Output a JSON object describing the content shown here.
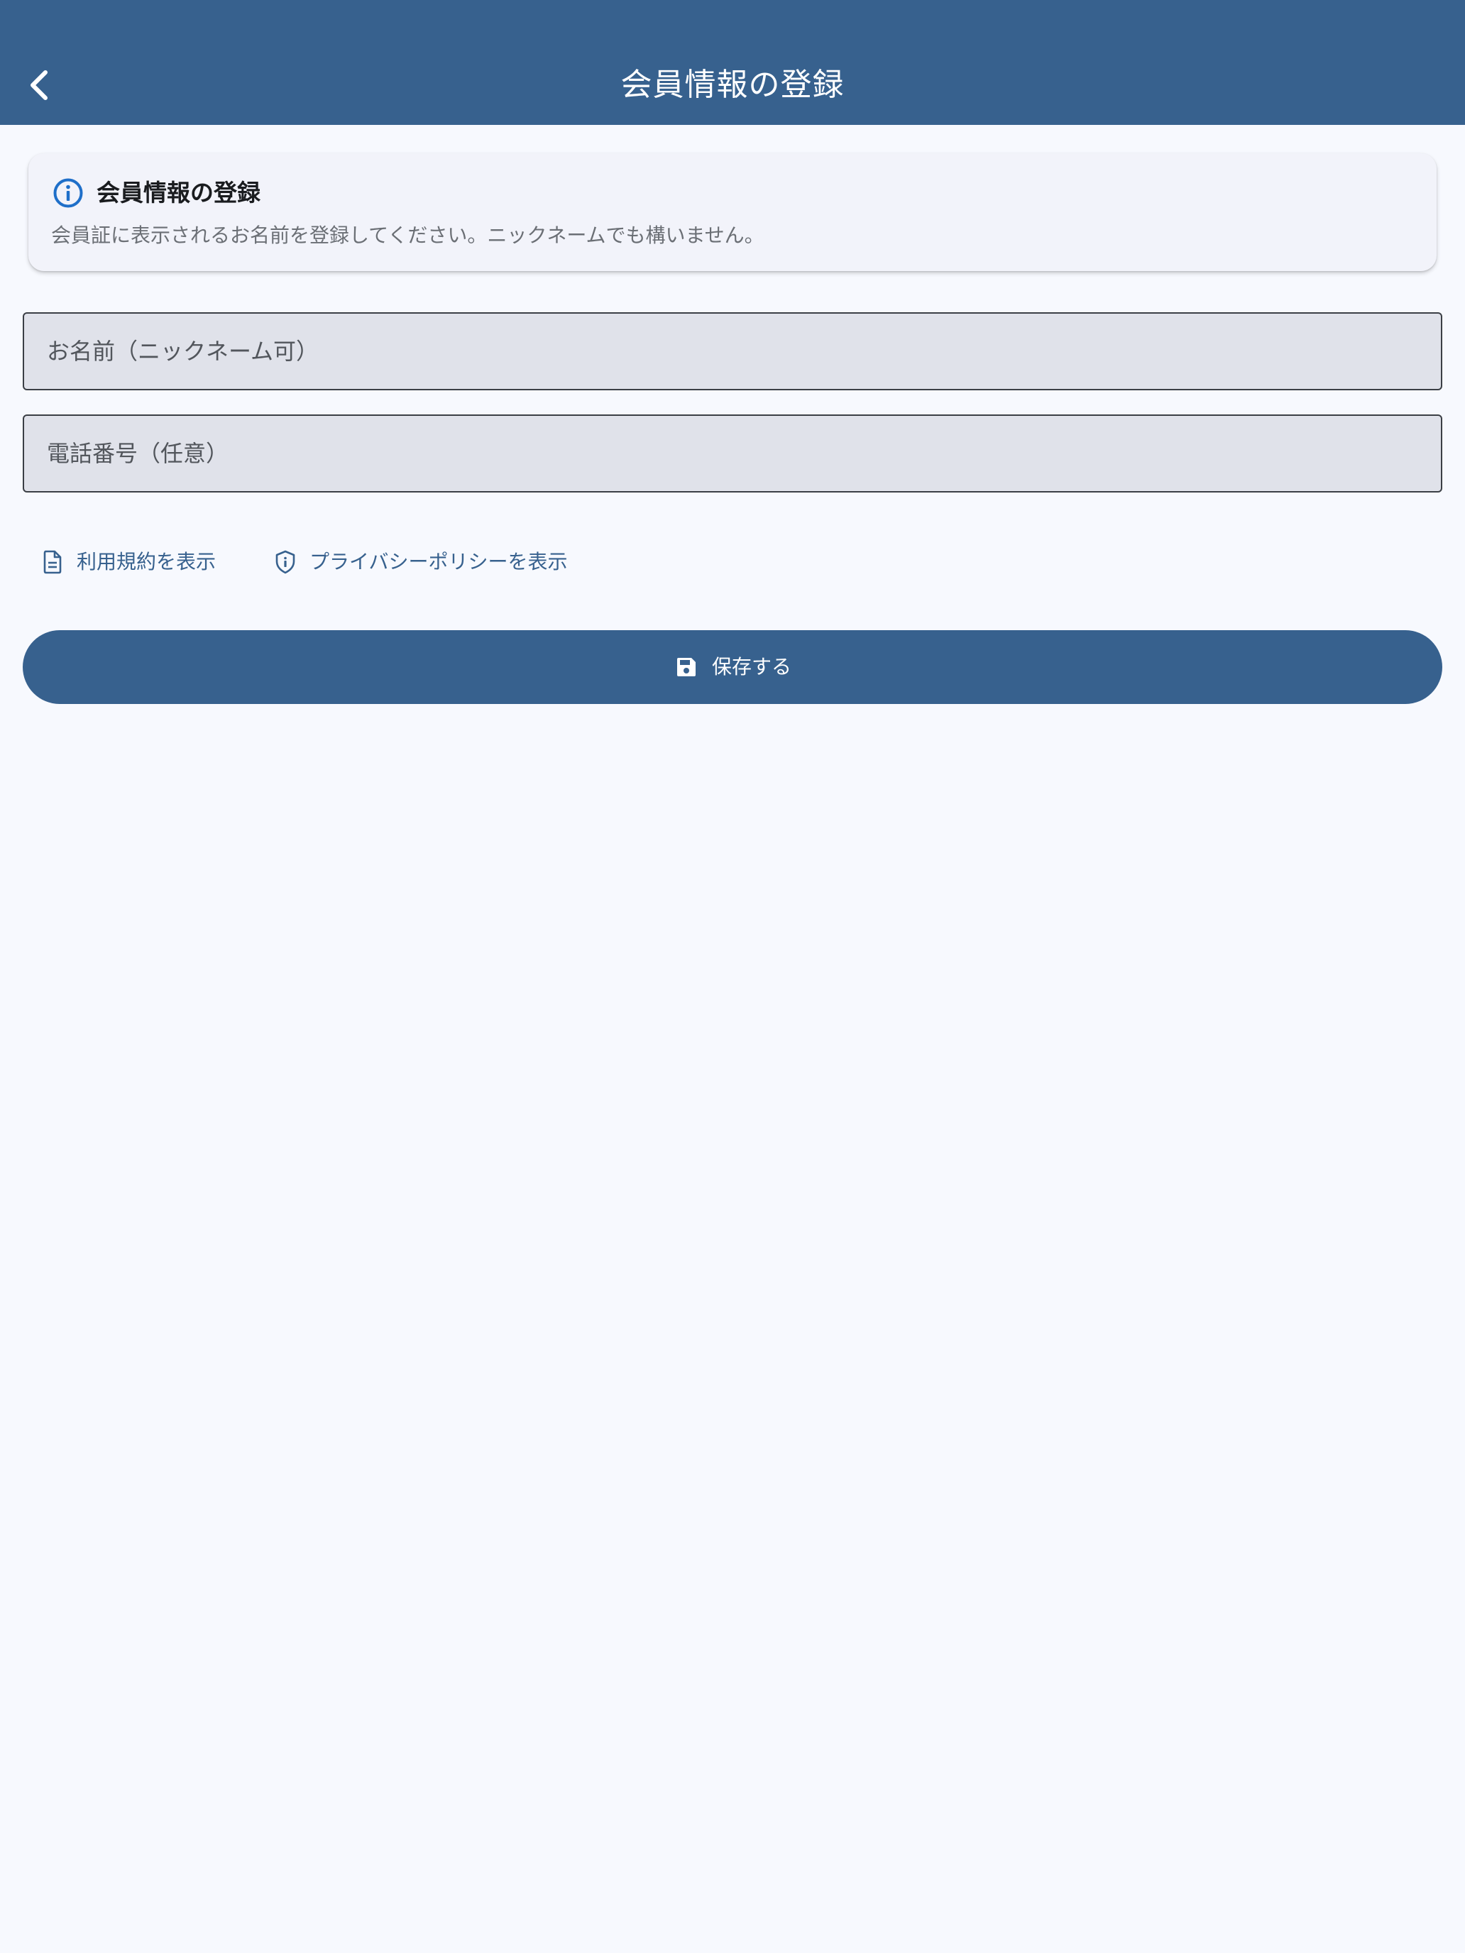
{
  "app_bar": {
    "title": "会員情報の登録",
    "back_icon": "chevron-left-icon"
  },
  "info_card": {
    "icon": "info-icon",
    "title": "会員情報の登録",
    "description": "会員証に表示されるお名前を登録してください。ニックネームでも構いません。"
  },
  "form": {
    "name_placeholder": "お名前（ニックネーム可）",
    "name_value": "",
    "phone_placeholder": "電話番号（任意）",
    "phone_value": ""
  },
  "links": {
    "terms_label": "利用規約を表示",
    "terms_icon": "document-icon",
    "privacy_label": "プライバシーポリシーを表示",
    "privacy_icon": "shield-icon"
  },
  "save_button": {
    "label": "保存する",
    "icon": "save-icon"
  },
  "colors": {
    "primary": "#37618e",
    "background": "#f7f9fe",
    "card": "#f2f3fa",
    "field": "#e0e2ea",
    "info_icon": "#1f6fc9"
  }
}
